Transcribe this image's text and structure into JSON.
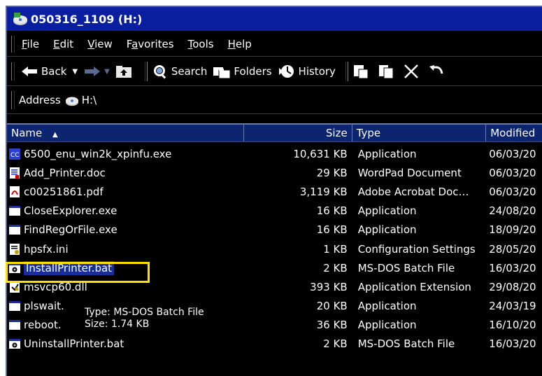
{
  "window": {
    "title": "050316_1109 (H:)"
  },
  "menu": [
    {
      "label": "File",
      "u": "F",
      "rest": "ile"
    },
    {
      "label": "Edit",
      "u": "E",
      "rest": "dit"
    },
    {
      "label": "View",
      "u": "V",
      "rest": "iew"
    },
    {
      "label": "Favorites",
      "u": "a",
      "pre": "F",
      "rest": "vorites"
    },
    {
      "label": "Tools",
      "u": "T",
      "rest": "ools"
    },
    {
      "label": "Help",
      "u": "H",
      "rest": "elp"
    }
  ],
  "toolbar": {
    "back": "Back",
    "search": "Search",
    "folders": "Folders",
    "history": "History"
  },
  "address": {
    "label": "Address",
    "value": "H:\\"
  },
  "columns": {
    "name": "Name",
    "sort_indicator": "▲",
    "size": "Size",
    "type": "Type",
    "modified": "Modified"
  },
  "files": [
    {
      "name": "6500_enu_win2k_xpinfu.exe",
      "size": "10,631 KB",
      "type": "Application",
      "modified": "06/03/20",
      "icon": "exe-icon"
    },
    {
      "name": "Add_Printer.doc",
      "size": "29 KB",
      "type": "WordPad Document",
      "modified": "06/03/20",
      "icon": "document-icon"
    },
    {
      "name": "c00251861.pdf",
      "size": "3,119 KB",
      "type": "Adobe Acrobat Doc…",
      "modified": "06/03/20",
      "icon": "pdf-icon"
    },
    {
      "name": "CloseExplorer.exe",
      "size": "16 KB",
      "type": "Application",
      "modified": "24/08/20",
      "icon": "app-window-icon"
    },
    {
      "name": "FindRegOrFile.exe",
      "size": "16 KB",
      "type": "Application",
      "modified": "18/09/20",
      "icon": "app-window-icon"
    },
    {
      "name": "hpsfx.ini",
      "size": "1 KB",
      "type": "Configuration Settings",
      "modified": "28/05/20",
      "icon": "config-file-icon"
    },
    {
      "name": "InstallPrinter.bat",
      "size": "2 KB",
      "type": "MS-DOS Batch File",
      "modified": "16/03/20",
      "icon": "batch-file-icon"
    },
    {
      "name": "msvcp60.dll",
      "size": "393 KB",
      "type": "Application Extension",
      "modified": "29/08/20",
      "icon": "dll-icon"
    },
    {
      "name": "plswait.",
      "size": "20 KB",
      "type": "Application",
      "modified": "24/03/19",
      "icon": "app-window-icon"
    },
    {
      "name": "reboot.",
      "size": "36 KB",
      "type": "Application",
      "modified": "16/10/20",
      "icon": "app-window-icon"
    },
    {
      "name": "UninstallPrinter.bat",
      "size": "2 KB",
      "type": "MS-DOS Batch File",
      "modified": "16/03/20",
      "icon": "batch-file-icon"
    }
  ],
  "tooltip": {
    "line1": "Type: MS-DOS Batch File",
    "line2": "Size: 1.74 KB"
  },
  "colors": {
    "titlebar": "#0a1fa0",
    "header": "#0d2470",
    "selection": "#1a2e9a",
    "highlight": "#ffe000"
  }
}
